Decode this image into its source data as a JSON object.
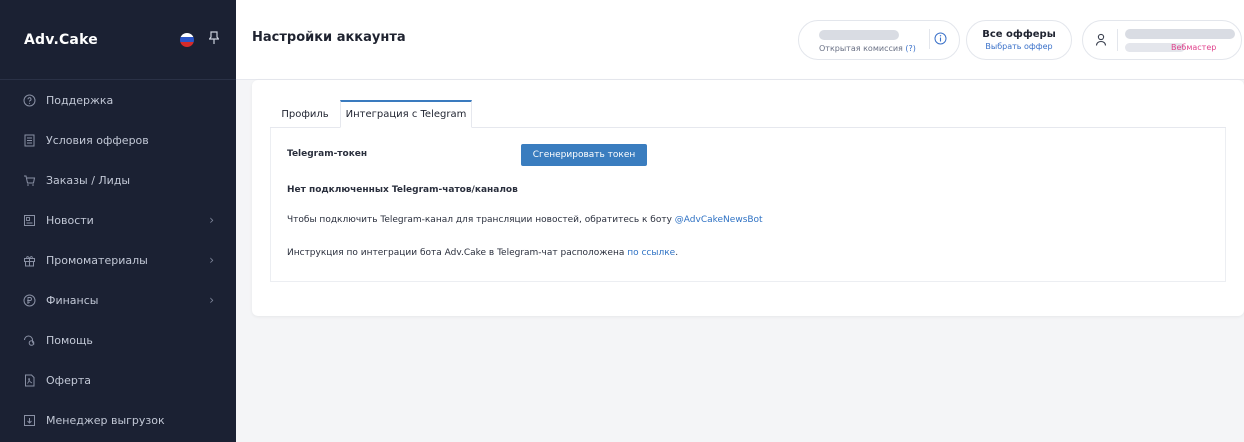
{
  "sidebar": {
    "logo": "Adv.Cake",
    "items": [
      {
        "label": "Поддержка",
        "icon": "help-circle-icon",
        "has_arrow": false
      },
      {
        "label": "Условия офферов",
        "icon": "document-list-icon",
        "has_arrow": false
      },
      {
        "label": "Заказы / Лиды",
        "icon": "cart-icon",
        "has_arrow": false
      },
      {
        "label": "Новости",
        "icon": "newspaper-icon",
        "has_arrow": true
      },
      {
        "label": "Промоматериалы",
        "icon": "gift-icon",
        "has_arrow": true
      },
      {
        "label": "Финансы",
        "icon": "ruble-circle-icon",
        "has_arrow": true
      },
      {
        "label": "Помощь",
        "icon": "help-chat-icon",
        "has_arrow": false
      },
      {
        "label": "Оферта",
        "icon": "pdf-document-icon",
        "has_arrow": false
      },
      {
        "label": "Менеджер выгрузок",
        "icon": "download-box-icon",
        "has_arrow": false
      }
    ]
  },
  "header": {
    "title": "Настройки аккаунта",
    "commission_label": "Открытая комиссия",
    "commission_hint": "(?)",
    "offers_title": "Все офферы",
    "offers_link": "Выбрать оффер",
    "user_role": "Вебмастер"
  },
  "tabs": {
    "profile": "Профиль",
    "telegram": "Интеграция с Telegram"
  },
  "telegram": {
    "token_label": "Telegram-токен",
    "generate_button": "Сгенерировать токен",
    "no_chats": "Нет подключенных Telegram-чатов/каналов",
    "connect_text": "Чтобы подключить Telegram-канал для трансляции новостей, обратитесь к боту ",
    "bot_link": "@AdvCakeNewsBot",
    "instruction_text": "Инструкция по интеграции бота Adv.Cake в Telegram-чат расположена ",
    "instruction_link": "по ссылке",
    "instruction_end": "."
  },
  "colors": {
    "sidebar_bg": "#1b2133",
    "accent": "#3a7dbf",
    "link": "#2f72c4",
    "role": "#e0428c"
  }
}
